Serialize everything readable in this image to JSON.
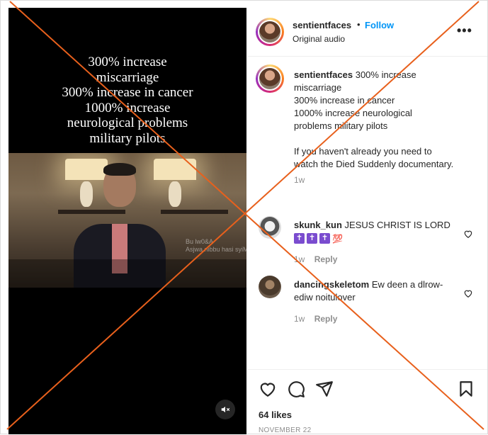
{
  "post": {
    "overlay_lines": [
      "300% increase",
      "miscarriage",
      "300% increase in cancer",
      "1000% increase",
      "neurological problems",
      "military pilots"
    ],
    "watermark": "Bu lw0&A\nAsjwa nibbu hasi syiM"
  },
  "header": {
    "username": "sentientfaces",
    "separator": "•",
    "follow_label": "Follow",
    "audio_label": "Original audio",
    "more_label": "•••"
  },
  "caption": {
    "username": "sentientfaces",
    "lines": [
      "300% increase",
      "miscarriage",
      "300% increase in cancer",
      "1000% increase neurological",
      "problems military pilots"
    ],
    "paragraph": "If you haven't already you need to watch the Died Suddenly documentary.",
    "time": "1w"
  },
  "comments": [
    {
      "username": "skunk_kun",
      "text": "JESUS CHRIST IS LORD",
      "emojis": [
        "✝",
        "✝",
        "✝",
        "💯"
      ],
      "time": "1w",
      "reply_label": "Reply"
    },
    {
      "username": "dancingskeletom",
      "text": "Ew deen a dlrow-ediw noitulover",
      "time": "1w",
      "reply_label": "Reply"
    }
  ],
  "footer": {
    "likes": "64 likes",
    "date": "NOVEMBER 22"
  },
  "colors": {
    "accent": "#0095f6",
    "cross": "#e8601c",
    "text": "#262626",
    "muted": "#8e8e8e"
  }
}
